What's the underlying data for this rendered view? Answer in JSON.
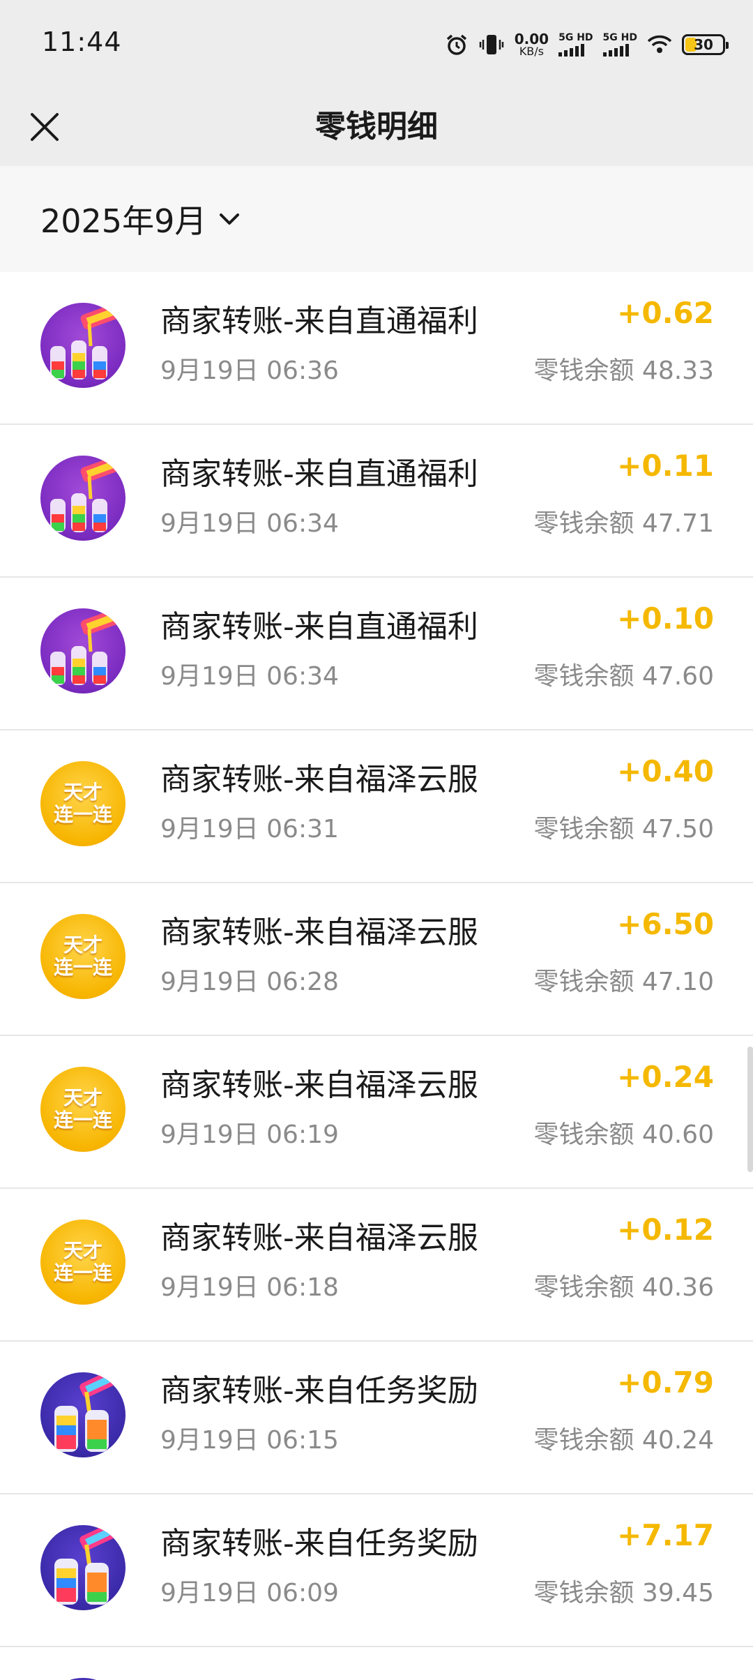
{
  "status_bar": {
    "time": "11:44",
    "net_speed_value": "0.00",
    "net_speed_unit": "KB/s",
    "sim1_label": "5G HD",
    "sim2_label": "5G HD",
    "battery": "30",
    "icons": [
      "alarm-icon",
      "vibrate-icon",
      "signal-icon",
      "wifi-icon",
      "battery-icon"
    ]
  },
  "nav": {
    "title": "零钱明细"
  },
  "filter": {
    "month": "2025年9月"
  },
  "colors": {
    "amount": "#f5b800",
    "header_bg": "#ededed",
    "filter_bg": "#f7f7f7"
  },
  "transactions": [
    {
      "title": "商家转账-来自直通福利",
      "time": "9月19日 06:36",
      "amount": "+0.62",
      "balance": "零钱余额 48.33",
      "icon": "color-bottles-app-icon"
    },
    {
      "title": "商家转账-来自直通福利",
      "time": "9月19日 06:34",
      "amount": "+0.11",
      "balance": "零钱余额 47.71",
      "icon": "color-bottles-app-icon"
    },
    {
      "title": "商家转账-来自直通福利",
      "time": "9月19日 06:34",
      "amount": "+0.10",
      "balance": "零钱余额 47.60",
      "icon": "color-bottles-app-icon"
    },
    {
      "title": "商家转账-来自福泽云服",
      "time": "9月19日 06:31",
      "amount": "+0.40",
      "balance": "零钱余额 47.50",
      "icon": "genius-link-app-icon",
      "icon_text": [
        "天才",
        "连一连"
      ]
    },
    {
      "title": "商家转账-来自福泽云服",
      "time": "9月19日 06:28",
      "amount": "+6.50",
      "balance": "零钱余额 47.10",
      "icon": "genius-link-app-icon",
      "icon_text": [
        "天才",
        "连一连"
      ]
    },
    {
      "title": "商家转账-来自福泽云服",
      "time": "9月19日 06:19",
      "amount": "+0.24",
      "balance": "零钱余额 40.60",
      "icon": "genius-link-app-icon",
      "icon_text": [
        "天才",
        "连一连"
      ]
    },
    {
      "title": "商家转账-来自福泽云服",
      "time": "9月19日 06:18",
      "amount": "+0.12",
      "balance": "零钱余额 40.36",
      "icon": "genius-link-app-icon",
      "icon_text": [
        "天才",
        "连一连"
      ]
    },
    {
      "title": "商家转账-来自任务奖励",
      "time": "9月19日 06:15",
      "amount": "+0.79",
      "balance": "零钱余额 40.24",
      "icon": "water-sort-app-icon"
    },
    {
      "title": "商家转账-来自任务奖励",
      "time": "9月19日 06:09",
      "amount": "+7.17",
      "balance": "零钱余额 39.45",
      "icon": "water-sort-app-icon"
    }
  ]
}
